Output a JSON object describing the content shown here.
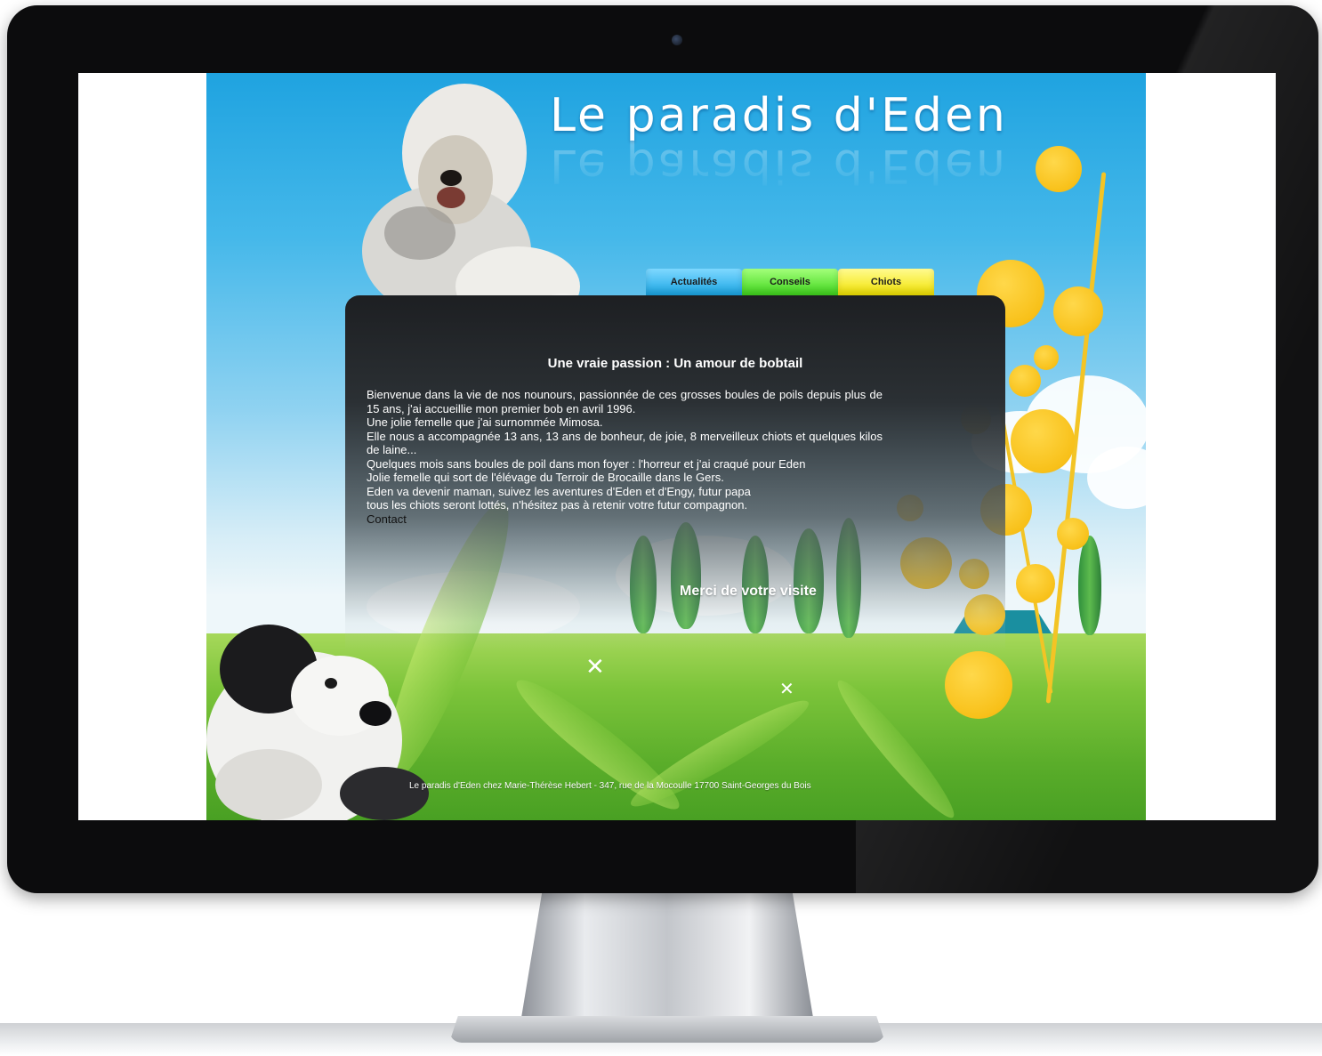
{
  "site": {
    "logo_text": "Le paradis d'Eden",
    "nav": [
      {
        "label": "Actualités",
        "color": "#1aa7e6"
      },
      {
        "label": "Conseils",
        "color": "#3fd61c"
      },
      {
        "label": "Chiots",
        "color": "#f2e300"
      }
    ],
    "heading": "Une vraie passion : Un amour de bobtail",
    "paragraphs": [
      "Bienvenue dans la vie de nos nounours, passionnée de ces grosses boules de poils depuis plus de 15 ans, j'ai accueillie mon premier bob en avril 1996.",
      "Une jolie femelle que j'ai surnommée Mimosa.",
      "Elle nous a accompagnée 13 ans, 13 ans de bonheur, de joie, 8 merveilleux chiots et quelques kilos de laine...",
      "Quelques mois sans boules de poil dans mon foyer : l'horreur et j'ai craqué pour Eden",
      "Jolie femelle qui sort de l'élévage du Terroir de Brocaille dans le Gers.",
      "Eden va devenir maman, suivez les aventures d'Eden et d'Engy, futur papa",
      "tous les chiots seront lottés, n'hésitez pas à retenir votre futur compagnon."
    ],
    "contact_link": "Contact",
    "merci": "Merci de votre visite",
    "footer": "Le paradis d'Eden chez Marie-Thérèse Hebert - 347, rue de la Mocoulle 17700 Saint-Georges du Bois"
  },
  "colors": {
    "sky": "#1fa3e0",
    "grass": "#5aad2a",
    "blossom": "#f8c11a",
    "panel": "#1d1f22"
  },
  "icons": {
    "camera": "camera-icon"
  }
}
